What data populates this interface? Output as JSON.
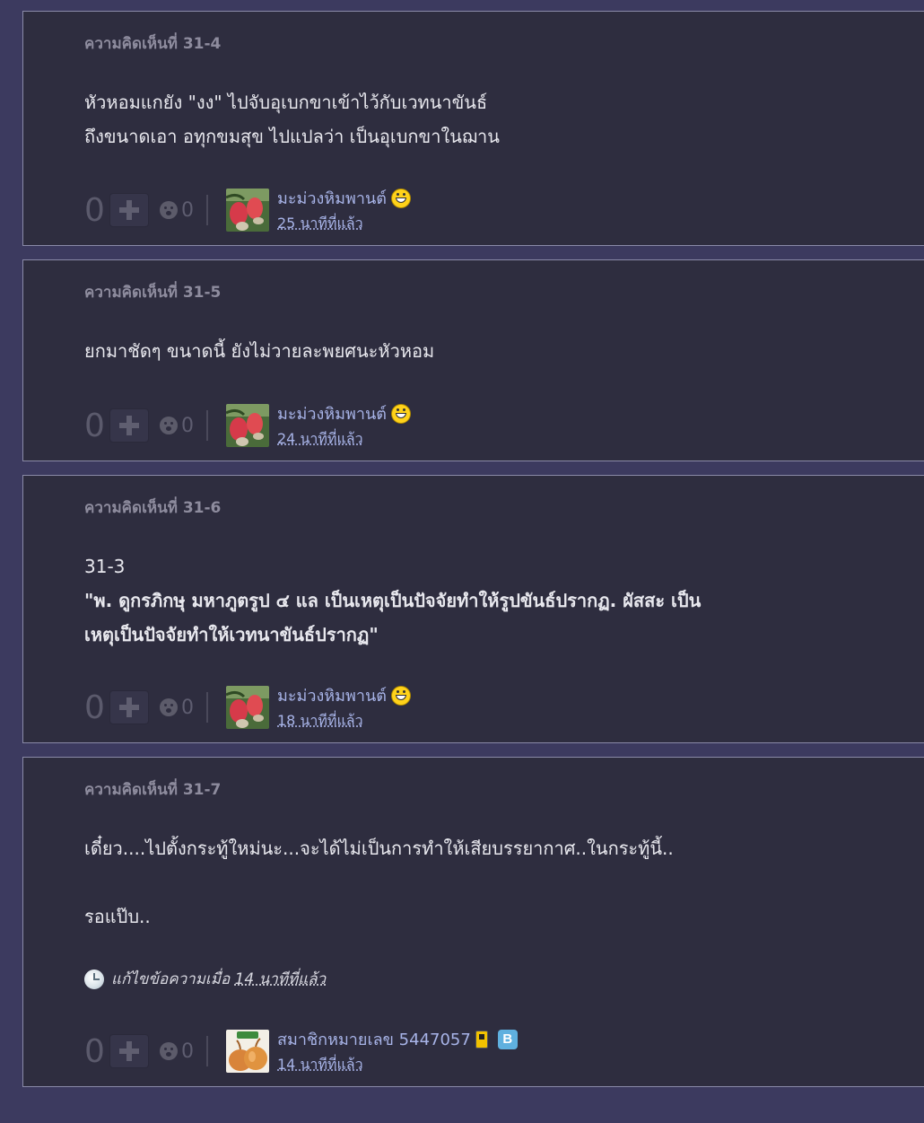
{
  "comments": [
    {
      "label": "ความคิดเห็นที่ 31-4",
      "lines": [
        "หัวหอมแกยัง \"งง\" ไปจับอุเบกขาเข้าไว้กับเวทนาขันธ์",
        "ถึงขนาดเอา อทุกขมสุข ไปแปลว่า เป็นอุเบกขาในฌาน"
      ],
      "votes": "0",
      "emotions": "0",
      "user": "มะม่วงหิมพานต์",
      "time": "25 นาทีที่แล้ว",
      "avatar": "cashew-avatar"
    },
    {
      "label": "ความคิดเห็นที่ 31-5",
      "lines": [
        "ยกมาชัดๆ ขนาดนี้ ยังไม่วายละพยศนะหัวหอม"
      ],
      "votes": "0",
      "emotions": "0",
      "user": "มะม่วงหิมพานต์",
      "time": "24 นาทีที่แล้ว",
      "avatar": "cashew-avatar"
    },
    {
      "label": "ความคิดเห็นที่ 31-6",
      "lines": [
        "31-3",
        "\"พ. ดูกรภิกษุ มหาภูตรูป ๔ แล เป็นเหตุเป็นปัจจัยทำให้รูปขันธ์ปรากฏ. ผัสสะ เป็น",
        "เหตุเป็นปัจจัยทำให้เวทนาขันธ์ปรากฏ\""
      ],
      "votes": "0",
      "emotions": "0",
      "user": "มะม่วงหิมพานต์",
      "time": "18 นาทีที่แล้ว",
      "avatar": "cashew-avatar"
    },
    {
      "label": "ความคิดเห็นที่ 31-7",
      "lines": [
        "เดี๋ยว....ไปตั้งกระทู้ใหม่นะ...จะได้ไม่เป็นการทำให้เสียบรรยากาศ..ในกระทู้นี้..",
        "รอแป๊บ.."
      ],
      "edit_prefix": "แก้ไขข้อความเมื่อ",
      "edit_time": "14 นาทีที่แล้ว",
      "votes": "0",
      "emotions": "0",
      "user": "สมาชิกหมายเลข 5447057",
      "time": "14 นาทีที่แล้ว",
      "avatar": "onion-avatar",
      "badge_b": "B"
    }
  ]
}
